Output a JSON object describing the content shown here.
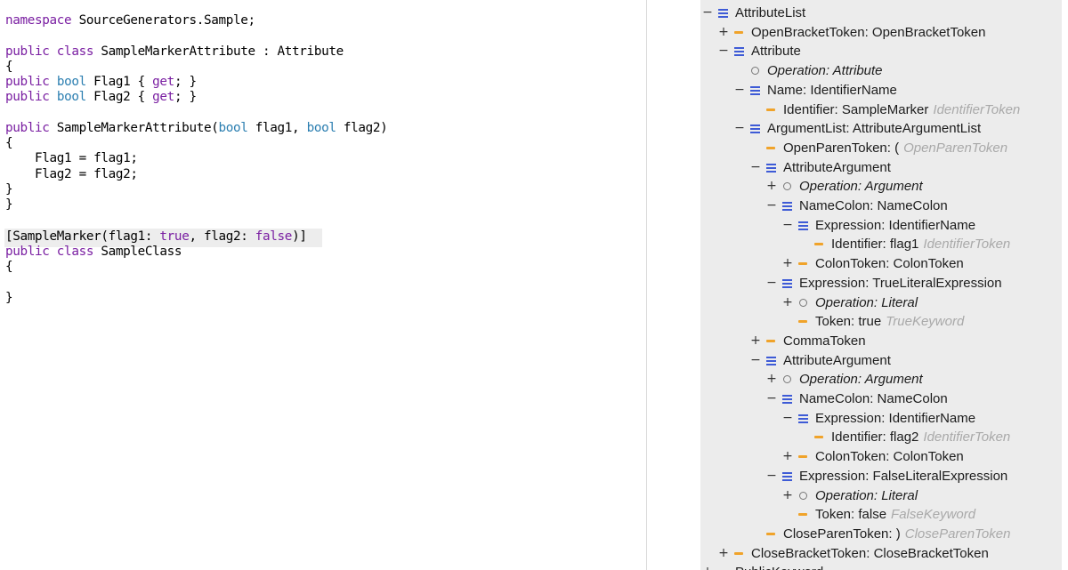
{
  "code": {
    "lines": [
      [
        {
          "t": "namespace",
          "c": "kw"
        },
        {
          "t": " SourceGenerators.Sample;"
        }
      ],
      [],
      [
        {
          "t": "public class",
          "c": "kw"
        },
        {
          "t": " SampleMarkerAttribute : Attribute"
        }
      ],
      [
        {
          "t": "{"
        }
      ],
      [
        {
          "t": "public",
          "c": "kw"
        },
        {
          "t": " "
        },
        {
          "t": "bool",
          "c": "ty"
        },
        {
          "t": " Flag1 { "
        },
        {
          "t": "get",
          "c": "kw"
        },
        {
          "t": "; }"
        }
      ],
      [
        {
          "t": "public",
          "c": "kw"
        },
        {
          "t": " "
        },
        {
          "t": "bool",
          "c": "ty"
        },
        {
          "t": " Flag2 { "
        },
        {
          "t": "get",
          "c": "kw"
        },
        {
          "t": "; }"
        }
      ],
      [],
      [
        {
          "t": "public",
          "c": "kw"
        },
        {
          "t": " SampleMarkerAttribute("
        },
        {
          "t": "bool",
          "c": "ty"
        },
        {
          "t": " flag1, "
        },
        {
          "t": "bool",
          "c": "ty"
        },
        {
          "t": " flag2)"
        }
      ],
      [
        {
          "t": "{"
        }
      ],
      [
        {
          "t": "    Flag1 = flag1;"
        }
      ],
      [
        {
          "t": "    Flag2 = flag2;"
        }
      ],
      [
        {
          "t": "}"
        }
      ],
      [
        {
          "t": "}"
        }
      ],
      [],
      [
        {
          "t": "[SampleMarker(flag1: "
        },
        {
          "t": "true",
          "c": "kw"
        },
        {
          "t": ", flag2: "
        },
        {
          "t": "false",
          "c": "kw"
        },
        {
          "t": ")]"
        }
      ],
      [
        {
          "t": "public class",
          "c": "kw"
        },
        {
          "t": " SampleClass"
        }
      ],
      [
        {
          "t": "{"
        }
      ],
      [],
      [
        {
          "t": "}"
        }
      ]
    ]
  },
  "tree": {
    "rows": [
      {
        "toggle": "−",
        "icon": "node",
        "label": "AttributeList",
        "level": 0
      },
      {
        "toggle": "+",
        "icon": "token",
        "label": "OpenBracketToken: OpenBracketToken",
        "level": 1
      },
      {
        "toggle": "−",
        "icon": "node",
        "label": "Attribute",
        "level": 1
      },
      {
        "toggle": "",
        "icon": "op",
        "label": "Operation: Attribute",
        "level": 2,
        "italic": true
      },
      {
        "toggle": "−",
        "icon": "node",
        "label": "Name: IdentifierName",
        "level": 2
      },
      {
        "toggle": "",
        "icon": "token",
        "label": "Identifier: SampleMarker",
        "kind": "IdentifierToken",
        "level": 3
      },
      {
        "toggle": "−",
        "icon": "node",
        "label": "ArgumentList: AttributeArgumentList",
        "level": 2
      },
      {
        "toggle": "",
        "icon": "token",
        "label": "OpenParenToken: (",
        "kind": "OpenParenToken",
        "level": 3
      },
      {
        "toggle": "−",
        "icon": "node",
        "label": "AttributeArgument",
        "level": 3
      },
      {
        "toggle": "+",
        "icon": "op",
        "label": "Operation: Argument",
        "level": 4,
        "italic": true
      },
      {
        "toggle": "−",
        "icon": "node",
        "label": "NameColon: NameColon",
        "level": 4
      },
      {
        "toggle": "−",
        "icon": "node",
        "label": "Expression: IdentifierName",
        "level": 5
      },
      {
        "toggle": "",
        "icon": "token",
        "label": "Identifier: flag1",
        "kind": "IdentifierToken",
        "level": 6
      },
      {
        "toggle": "+",
        "icon": "token",
        "label": "ColonToken: ColonToken",
        "level": 5
      },
      {
        "toggle": "−",
        "icon": "node",
        "label": "Expression: TrueLiteralExpression",
        "level": 4
      },
      {
        "toggle": "+",
        "icon": "op",
        "label": "Operation: Literal",
        "level": 5,
        "italic": true
      },
      {
        "toggle": "",
        "icon": "token",
        "label": "Token: true",
        "kind": "TrueKeyword",
        "level": 5
      },
      {
        "toggle": "+",
        "icon": "token",
        "label": "CommaToken",
        "level": 3
      },
      {
        "toggle": "−",
        "icon": "node",
        "label": "AttributeArgument",
        "level": 3
      },
      {
        "toggle": "+",
        "icon": "op",
        "label": "Operation: Argument",
        "level": 4,
        "italic": true
      },
      {
        "toggle": "−",
        "icon": "node",
        "label": "NameColon: NameColon",
        "level": 4
      },
      {
        "toggle": "−",
        "icon": "node",
        "label": "Expression: IdentifierName",
        "level": 5
      },
      {
        "toggle": "",
        "icon": "token",
        "label": "Identifier: flag2",
        "kind": "IdentifierToken",
        "level": 6
      },
      {
        "toggle": "+",
        "icon": "token",
        "label": "ColonToken: ColonToken",
        "level": 5
      },
      {
        "toggle": "−",
        "icon": "node",
        "label": "Expression: FalseLiteralExpression",
        "level": 4
      },
      {
        "toggle": "+",
        "icon": "op",
        "label": "Operation: Literal",
        "level": 5,
        "italic": true
      },
      {
        "toggle": "",
        "icon": "token",
        "label": "Token: false",
        "kind": "FalseKeyword",
        "level": 5
      },
      {
        "toggle": "",
        "icon": "token",
        "label": "CloseParenToken: )",
        "kind": "CloseParenToken",
        "level": 3
      },
      {
        "toggle": "+",
        "icon": "token",
        "label": "CloseBracketToken: CloseBracketToken",
        "level": 1
      },
      {
        "toggle": "+",
        "icon": "token",
        "label": "PublicKeyword",
        "level": 0
      }
    ]
  }
}
